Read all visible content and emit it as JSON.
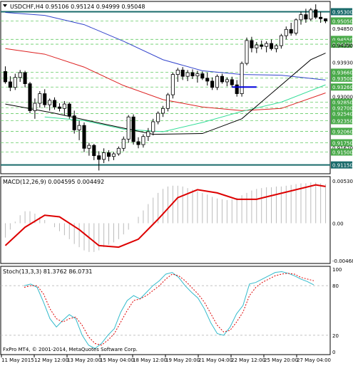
{
  "window": {
    "symbol_line": "USDCHF,H4 0.95106 0.95124 0.94999 0.95048",
    "copyright": "FxPro MT4, © 2001-2014, MetaQuotes Software Corp."
  },
  "colors": {
    "bull_candle": "#ffffff",
    "bear_candle": "#000000",
    "ma_fast": "#000000",
    "ma_blue": "#3344cc",
    "ma_red": "#dd2222",
    "ma_green": "#33dd99",
    "level_teal": "#1a6b6b",
    "level_green_dash": "#66cc66",
    "macd_signal": "#dd0000",
    "macd_hist": "#bbbbbb",
    "stoch_main": "#33bbcc",
    "stoch_signal": "#dd0000",
    "trendline_blue": "#0000dd",
    "label_box_green": "#4aaa4a",
    "label_box_teal": "#1a6b6b"
  },
  "chart_data": [
    {
      "type": "candlestick",
      "title": "USDCHF,H4 0.95106 0.95124 0.94999 0.95048",
      "y_range": [
        0.9095,
        0.9554
      ],
      "x_tick_labels": [
        "11 May 2015",
        "12 May 12:00",
        "13 May 20:00",
        "15 May 04:00",
        "18 May 12:00",
        "19 May 20:00",
        "21 May 04:00",
        "22 May 12:00",
        "25 May 20:00",
        "27 May 04:00"
      ],
      "y_tick_labels": [
        {
          "value": 0.953,
          "label": "0.95300",
          "style": "teal_box"
        },
        {
          "value": 0.9505,
          "label": "0.95050",
          "style": "green_box"
        },
        {
          "value": 0.9485,
          "label": "0.94850",
          "style": "plain"
        },
        {
          "value": 0.9455,
          "label": "0.94550",
          "style": "green_box"
        },
        {
          "value": 0.9442,
          "label": "0.94420",
          "style": "green_box"
        },
        {
          "value": 0.9439,
          "label": "0.94390",
          "style": "plain"
        },
        {
          "value": 0.9393,
          "label": "0.93930",
          "style": "plain"
        },
        {
          "value": 0.9366,
          "label": "0.93660",
          "style": "green_box"
        },
        {
          "value": 0.935,
          "label": "0.93500",
          "style": "green_box"
        },
        {
          "value": 0.9326,
          "label": "0.93260",
          "style": "green_box"
        },
        {
          "value": 0.93,
          "label": "0.93000",
          "style": "plain"
        },
        {
          "value": 0.9285,
          "label": "0.92850",
          "style": "green_box"
        },
        {
          "value": 0.927,
          "label": "0.92700",
          "style": "green_box"
        },
        {
          "value": 0.9254,
          "label": "0.92540",
          "style": "green_box"
        },
        {
          "value": 0.9235,
          "label": "0.92350",
          "style": "green_box"
        },
        {
          "value": 0.9206,
          "label": "0.92060",
          "style": "green_box"
        },
        {
          "value": 0.9175,
          "label": "0.91750",
          "style": "green_box"
        },
        {
          "value": 0.9162,
          "label": "0.91620",
          "style": "plain"
        },
        {
          "value": 0.915,
          "label": "0.91500",
          "style": "green_box"
        },
        {
          "value": 0.9115,
          "label": "0.91150",
          "style": "teal_box"
        }
      ],
      "horizontal_levels": [
        {
          "value": 0.953,
          "style": "solid_teal"
        },
        {
          "value": 0.9115,
          "style": "solid_teal"
        },
        {
          "value": 0.9505,
          "style": "dash_green"
        },
        {
          "value": 0.9455,
          "style": "dash_green"
        },
        {
          "value": 0.9442,
          "style": "dash_green"
        },
        {
          "value": 0.9366,
          "style": "dash_green"
        },
        {
          "value": 0.935,
          "style": "dash_green"
        },
        {
          "value": 0.9326,
          "style": "dash_green"
        },
        {
          "value": 0.9285,
          "style": "dash_green"
        },
        {
          "value": 0.927,
          "style": "dash_green"
        },
        {
          "value": 0.9254,
          "style": "dash_green"
        },
        {
          "value": 0.9235,
          "style": "dash_green"
        },
        {
          "value": 0.9206,
          "style": "dash_green"
        },
        {
          "value": 0.9175,
          "style": "dash_green"
        },
        {
          "value": 0.915,
          "style": "dash_green"
        }
      ],
      "candles": [
        [
          0.9368,
          0.9382,
          0.9335,
          0.934
        ],
        [
          0.934,
          0.9355,
          0.9315,
          0.9325
        ],
        [
          0.9325,
          0.9362,
          0.9318,
          0.9352
        ],
        [
          0.9352,
          0.9372,
          0.934,
          0.9365
        ],
        [
          0.9365,
          0.937,
          0.9325,
          0.9335
        ],
        [
          0.9335,
          0.934,
          0.9255,
          0.9262
        ],
        [
          0.9262,
          0.9295,
          0.924,
          0.9282
        ],
        [
          0.9282,
          0.9315,
          0.927,
          0.9308
        ],
        [
          0.9308,
          0.932,
          0.927,
          0.9278
        ],
        [
          0.9278,
          0.9295,
          0.9262,
          0.929
        ],
        [
          0.929,
          0.9298,
          0.9265,
          0.9272
        ],
        [
          0.9272,
          0.9282,
          0.926,
          0.9268
        ],
        [
          0.9268,
          0.9288,
          0.925,
          0.928
        ],
        [
          0.928,
          0.9285,
          0.924,
          0.9248
        ],
        [
          0.9248,
          0.9262,
          0.92,
          0.921
        ],
        [
          0.921,
          0.9235,
          0.9182,
          0.9222
        ],
        [
          0.9222,
          0.923,
          0.915,
          0.916
        ],
        [
          0.916,
          0.9175,
          0.914,
          0.9168
        ],
        [
          0.9168,
          0.9172,
          0.9128,
          0.914
        ],
        [
          0.914,
          0.9152,
          0.91,
          0.913
        ],
        [
          0.913,
          0.916,
          0.912,
          0.9148
        ],
        [
          0.9148,
          0.9155,
          0.9125,
          0.9138
        ],
        [
          0.9138,
          0.915,
          0.9128,
          0.9145
        ],
        [
          0.9145,
          0.9165,
          0.914,
          0.916
        ],
        [
          0.916,
          0.9192,
          0.9152,
          0.9185
        ],
        [
          0.9185,
          0.925,
          0.9175,
          0.9245
        ],
        [
          0.9245,
          0.9252,
          0.917,
          0.9178
        ],
        [
          0.9178,
          0.919,
          0.916,
          0.917
        ],
        [
          0.917,
          0.9198,
          0.9162,
          0.9192
        ],
        [
          0.9192,
          0.9215,
          0.918,
          0.9205
        ],
        [
          0.9205,
          0.924,
          0.9195,
          0.9232
        ],
        [
          0.9232,
          0.926,
          0.9225,
          0.9255
        ],
        [
          0.9255,
          0.9275,
          0.9245,
          0.9268
        ],
        [
          0.9268,
          0.931,
          0.926,
          0.9305
        ],
        [
          0.9305,
          0.9365,
          0.9295,
          0.936
        ],
        [
          0.936,
          0.9378,
          0.934,
          0.9372
        ],
        [
          0.9372,
          0.938,
          0.9345,
          0.9355
        ],
        [
          0.9355,
          0.9372,
          0.9342,
          0.9365
        ],
        [
          0.9365,
          0.9374,
          0.9348,
          0.9356
        ],
        [
          0.9356,
          0.937,
          0.9338,
          0.9362
        ],
        [
          0.9362,
          0.9368,
          0.9345,
          0.935
        ],
        [
          0.935,
          0.9365,
          0.933,
          0.9342
        ],
        [
          0.9342,
          0.9352,
          0.9318,
          0.9325
        ],
        [
          0.9325,
          0.936,
          0.9318,
          0.9355
        ],
        [
          0.9355,
          0.9362,
          0.9335,
          0.934
        ],
        [
          0.934,
          0.9352,
          0.9328,
          0.9346
        ],
        [
          0.9346,
          0.9354,
          0.9326,
          0.9332
        ],
        [
          0.9332,
          0.9345,
          0.93,
          0.9308
        ],
        [
          0.9308,
          0.9395,
          0.93,
          0.939
        ],
        [
          0.939,
          0.946,
          0.9385,
          0.9452
        ],
        [
          0.9452,
          0.9462,
          0.942,
          0.9432
        ],
        [
          0.9432,
          0.9448,
          0.9418,
          0.944
        ],
        [
          0.944,
          0.9452,
          0.9428,
          0.9436
        ],
        [
          0.9436,
          0.945,
          0.942,
          0.9444
        ],
        [
          0.9444,
          0.9455,
          0.9425,
          0.943
        ],
        [
          0.943,
          0.9442,
          0.942,
          0.9438
        ],
        [
          0.9438,
          0.947,
          0.943,
          0.9465
        ],
        [
          0.9465,
          0.949,
          0.9455,
          0.9482
        ],
        [
          0.9482,
          0.95,
          0.9465,
          0.9472
        ],
        [
          0.9472,
          0.9512,
          0.9466,
          0.9508
        ],
        [
          0.9508,
          0.953,
          0.9495,
          0.9522
        ],
        [
          0.9522,
          0.9538,
          0.95,
          0.951
        ],
        [
          0.951,
          0.954,
          0.9505,
          0.9535
        ],
        [
          0.9535,
          0.955,
          0.951,
          0.9515
        ],
        [
          0.9515,
          0.953,
          0.95,
          0.9511
        ],
        [
          0.9511,
          0.9512,
          0.9499,
          0.9505
        ]
      ],
      "ma_black": [
        [
          0,
          0.928
        ],
        [
          10,
          0.9255
        ],
        [
          20,
          0.9226
        ],
        [
          30,
          0.9198
        ],
        [
          40,
          0.92
        ],
        [
          48,
          0.924
        ],
        [
          55,
          0.932
        ],
        [
          62,
          0.94
        ],
        [
          65,
          0.9418
        ]
      ],
      "ma_blue": [
        [
          0,
          0.9528
        ],
        [
          8,
          0.952
        ],
        [
          16,
          0.9495
        ],
        [
          24,
          0.945
        ],
        [
          32,
          0.94
        ],
        [
          40,
          0.937
        ],
        [
          48,
          0.936
        ],
        [
          56,
          0.9358
        ],
        [
          65,
          0.9345
        ]
      ],
      "ma_red": [
        [
          0,
          0.943
        ],
        [
          8,
          0.9415
        ],
        [
          16,
          0.938
        ],
        [
          24,
          0.933
        ],
        [
          32,
          0.9292
        ],
        [
          40,
          0.9272
        ],
        [
          48,
          0.9262
        ],
        [
          56,
          0.9268
        ],
        [
          65,
          0.931
        ]
      ],
      "ma_green": [
        [
          8,
          0.9245
        ],
        [
          16,
          0.9235
        ],
        [
          24,
          0.9212
        ],
        [
          32,
          0.9205
        ],
        [
          40,
          0.923
        ],
        [
          48,
          0.926
        ],
        [
          56,
          0.9285
        ],
        [
          65,
          0.9332
        ]
      ],
      "trendline": {
        "x1": 46,
        "x2": 51,
        "y": 0.9326
      }
    },
    {
      "type": "bar",
      "title": "MACD(12,26,9) 0.004595 0.004492",
      "y_range": [
        -0.004686,
        0.005307
      ],
      "y_tick_labels": [
        {
          "value": 0.005307,
          "label": "0.005307"
        },
        {
          "value": 0.0,
          "label": "0.00"
        },
        {
          "value": -0.004686,
          "label": "-0.004686"
        }
      ],
      "histogram": [
        -0.0018,
        -0.0008,
        0.0002,
        0.001,
        0.0015,
        0.0015,
        0.0012,
        0.0008,
        0.0004,
        0.0,
        -0.0005,
        -0.001,
        -0.0015,
        -0.002,
        -0.0026,
        -0.003,
        -0.0034,
        -0.0036,
        -0.0036,
        -0.0034,
        -0.003,
        -0.0027,
        -0.0024,
        -0.002,
        -0.0014,
        -0.0008,
        0.0,
        0.0008,
        0.0016,
        0.0024,
        0.0032,
        0.0038,
        0.0043,
        0.0046,
        0.0047,
        0.0047,
        0.0046,
        0.0044,
        0.0042,
        0.004,
        0.0038,
        0.0036,
        0.0033,
        0.0031,
        0.003,
        0.0029,
        0.003,
        0.0032,
        0.0035,
        0.0038,
        0.0041,
        0.0043,
        0.0044,
        0.0045,
        0.0045,
        0.0046,
        0.0046,
        0.0047,
        0.0048,
        0.0049,
        0.005,
        0.005,
        0.0051,
        0.0051,
        0.005,
        0.0049
      ],
      "signal": [
        [
          0,
          -0.0028
        ],
        [
          4,
          -0.0005
        ],
        [
          8,
          0.001
        ],
        [
          11,
          0.0008
        ],
        [
          15,
          -0.0008
        ],
        [
          19,
          -0.0028
        ],
        [
          23,
          -0.003
        ],
        [
          27,
          -0.002
        ],
        [
          31,
          0.0005
        ],
        [
          35,
          0.0032
        ],
        [
          39,
          0.0042
        ],
        [
          43,
          0.0038
        ],
        [
          47,
          0.003
        ],
        [
          51,
          0.003
        ],
        [
          55,
          0.0036
        ],
        [
          59,
          0.0042
        ],
        [
          63,
          0.0048
        ],
        [
          65,
          0.0046
        ]
      ]
    },
    {
      "type": "line",
      "title": "Stoch(13,3,3) 81.3762 86.0731",
      "y_range": [
        0,
        100
      ],
      "y_tick_labels": [
        {
          "value": 100,
          "label": "100"
        },
        {
          "value": 80,
          "label": "80"
        },
        {
          "value": 20,
          "label": "20"
        },
        {
          "value": 0,
          "label": "0"
        }
      ],
      "series": [
        {
          "values": [
            80,
            82,
            78,
            60,
            40,
            30,
            38,
            45,
            40,
            20,
            8,
            4,
            10,
            20,
            28,
            48,
            62,
            68,
            64,
            72,
            80,
            86,
            94,
            96,
            90,
            80,
            72,
            65,
            52,
            35,
            22,
            20,
            30,
            46,
            56,
            82,
            84,
            88,
            92,
            96,
            97,
            95,
            92,
            88,
            85,
            81
          ]
        },
        {
          "values": [
            78,
            80,
            80,
            70,
            52,
            40,
            36,
            40,
            42,
            32,
            18,
            10,
            8,
            14,
            22,
            36,
            50,
            62,
            64,
            68,
            74,
            80,
            88,
            94,
            92,
            86,
            78,
            70,
            60,
            46,
            32,
            24,
            26,
            36,
            48,
            68,
            78,
            84,
            88,
            92,
            94,
            95,
            94,
            90,
            88,
            86
          ]
        }
      ]
    }
  ]
}
